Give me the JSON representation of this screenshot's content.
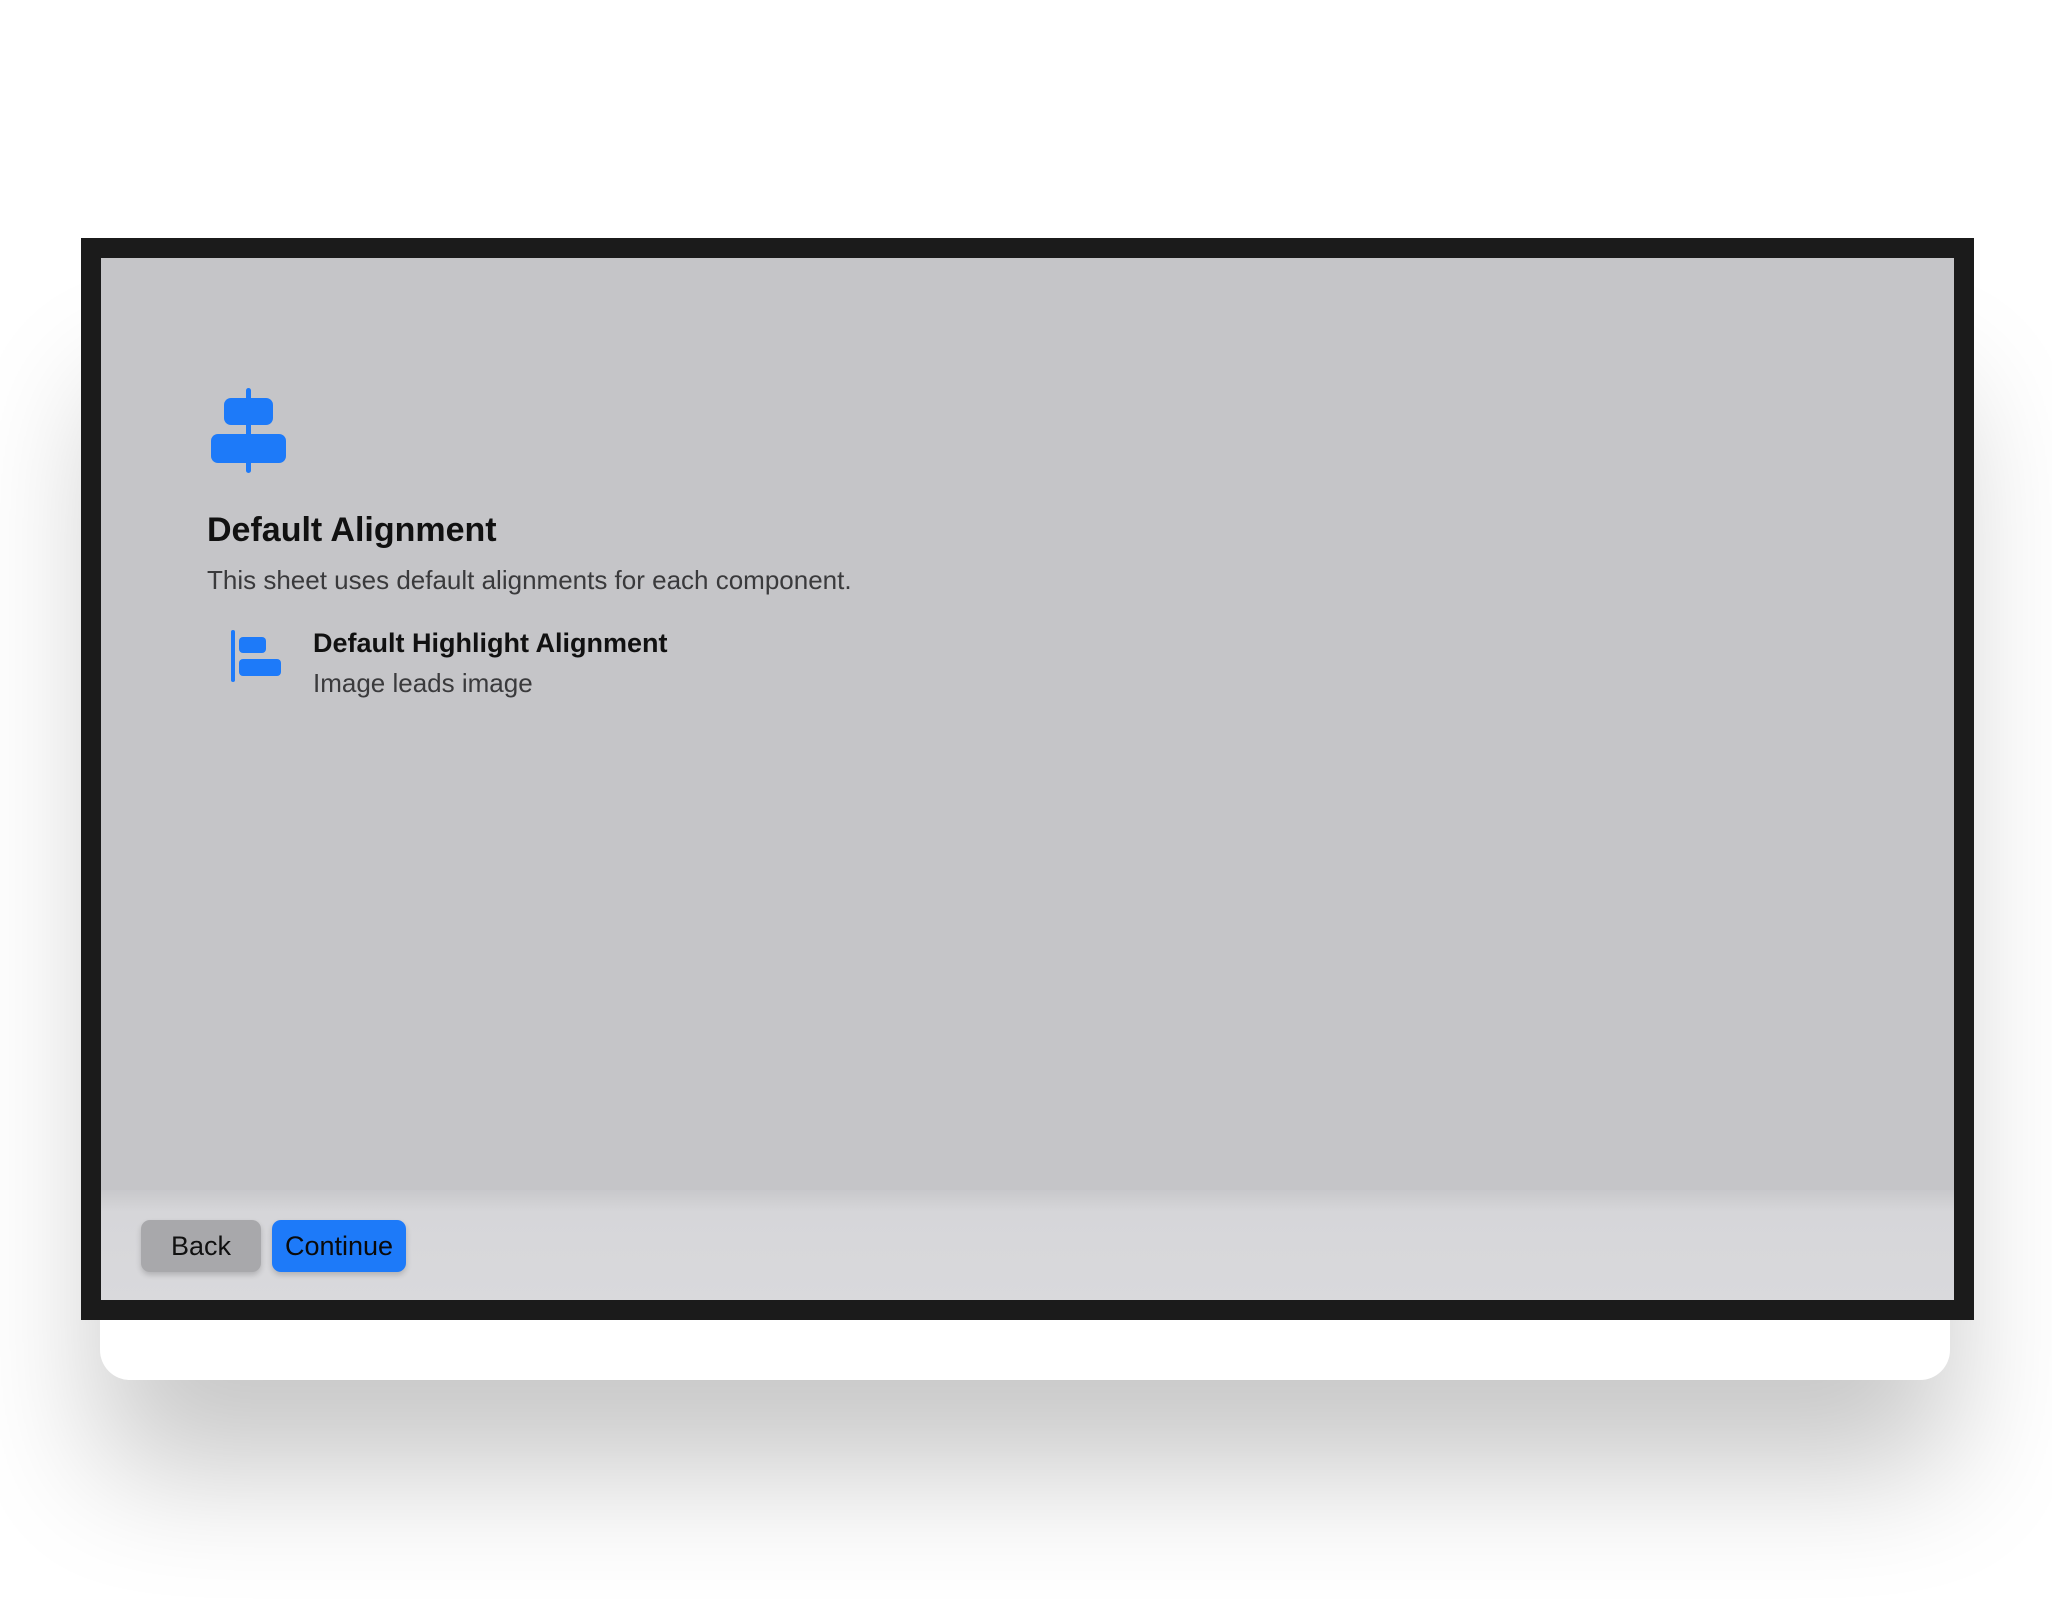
{
  "sheet": {
    "icon": "align-horizontal-center-icon",
    "title": "Default Alignment",
    "subtitle": "This sheet uses default alignments for each component."
  },
  "feature": {
    "icon": "align-horizontal-left-icon",
    "title": "Default Highlight Alignment",
    "detail": "Image leads image"
  },
  "footer": {
    "back_label": "Back",
    "continue_label": "Continue"
  },
  "colors": {
    "accent": "#1d7af9",
    "screen_background": "#c5c5c8",
    "frame": "#1b1b1b",
    "secondary_button": "#a8a8ab"
  }
}
